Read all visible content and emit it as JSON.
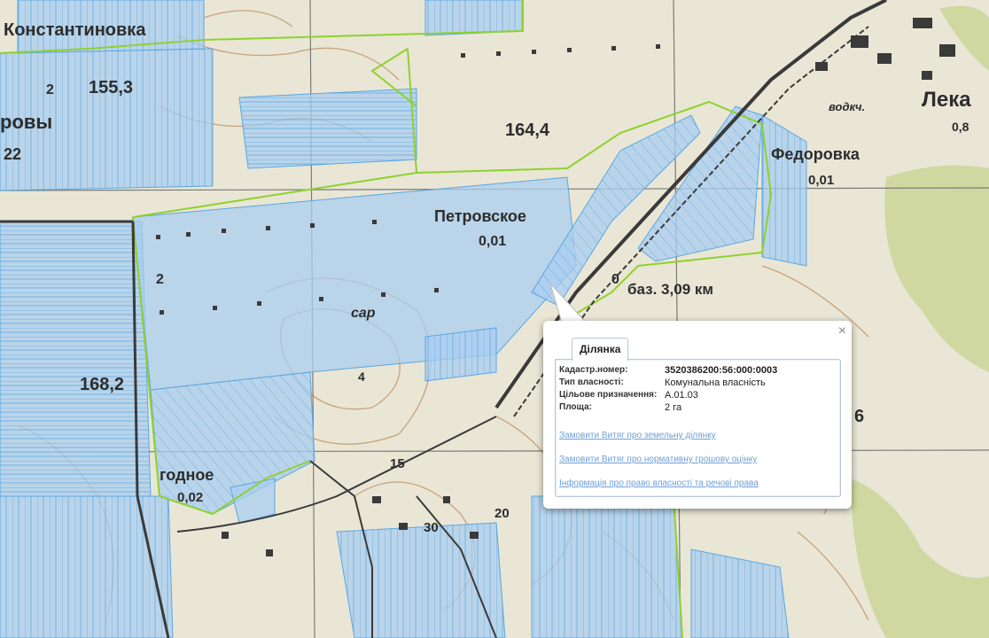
{
  "map": {
    "labels": {
      "konstantinovka": "Константиновка",
      "elev_155": "155,3",
      "rovy": "ровы",
      "rovy_num": "22",
      "elev_164": "164,4",
      "petrovskoe": "Петровское",
      "petrovskoe_num": "0,01",
      "fedorovka": "Федоровка",
      "fedorovka_num": "0,01",
      "leka": "Лека",
      "leka_num": "0,8",
      "baz": "баз. 3,09 км",
      "sar": "сар",
      "elev_168": "168,2",
      "godnoe": "годное",
      "godnoe_num": "0,02",
      "num_30": "30",
      "num_20": "20",
      "num_15": "15",
      "num_6": "6",
      "num_2a": "2",
      "num_2b": "2",
      "num_4": "4",
      "num_0": "0",
      "vodokach": "водкч."
    }
  },
  "popup": {
    "tab_label": "Ділянка",
    "close_label": "×",
    "fields": [
      {
        "key": "Кадастр.номер:",
        "value": "3520386200:56:000:0003"
      },
      {
        "key": "Тип власності:",
        "value": "Комунальна власність"
      },
      {
        "key": "Цільове призначення:",
        "value": "А.01.03"
      },
      {
        "key": "Площа:",
        "value": "2 га"
      }
    ],
    "links": {
      "extract_land": "Замовити Витяг про земельну ділянку",
      "extract_valuation": "Замовити Витяг про нормативну грошову оцінку",
      "ownership_info": "Інформація про право власності та речові права"
    }
  },
  "colors": {
    "parcel_fill": "#a9cdf0",
    "parcel_stroke": "#5aa7e0",
    "boundary": "#8fd12e",
    "road": "#3a3a3a",
    "contour": "#c9a27a",
    "forest": "#cfd8a0",
    "link": "#6d9ed6"
  }
}
